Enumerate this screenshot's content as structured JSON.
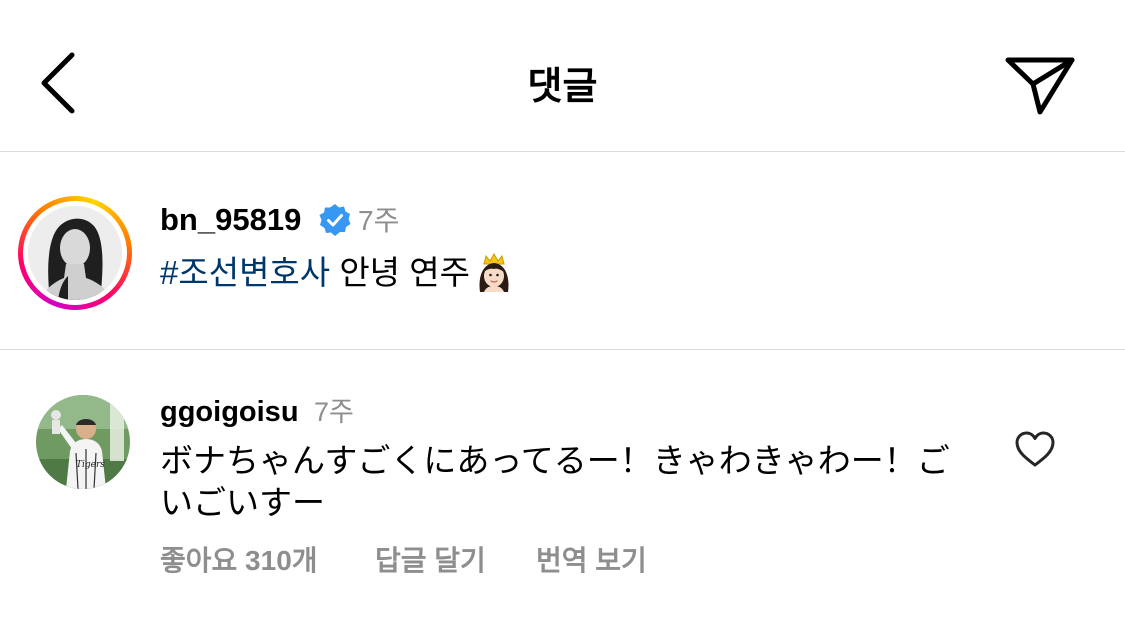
{
  "header": {
    "title": "댓글",
    "back_icon": "chevron-left-icon",
    "send_icon": "paper-plane-icon"
  },
  "caption": {
    "username": "bn_95819",
    "verified": true,
    "time": "7주",
    "hashtag": "#조선변호사",
    "text": " 안녕 연주",
    "emoji": "princess-emoji"
  },
  "comment": {
    "username": "ggoigoisu",
    "time": "7주",
    "text": "ボナちゃんすごくにあってるー！きゃわきゃわー！ごいごいすー",
    "likes_label": "좋아요 310개",
    "reply_label": "답글 달기",
    "translate_label": "번역 보기",
    "like_icon": "heart-outline-icon"
  },
  "colors": {
    "hashtag": "#00376b",
    "verified": "#3897f0",
    "secondary_text": "#8e8e8e",
    "divider": "#dbdbdb"
  }
}
